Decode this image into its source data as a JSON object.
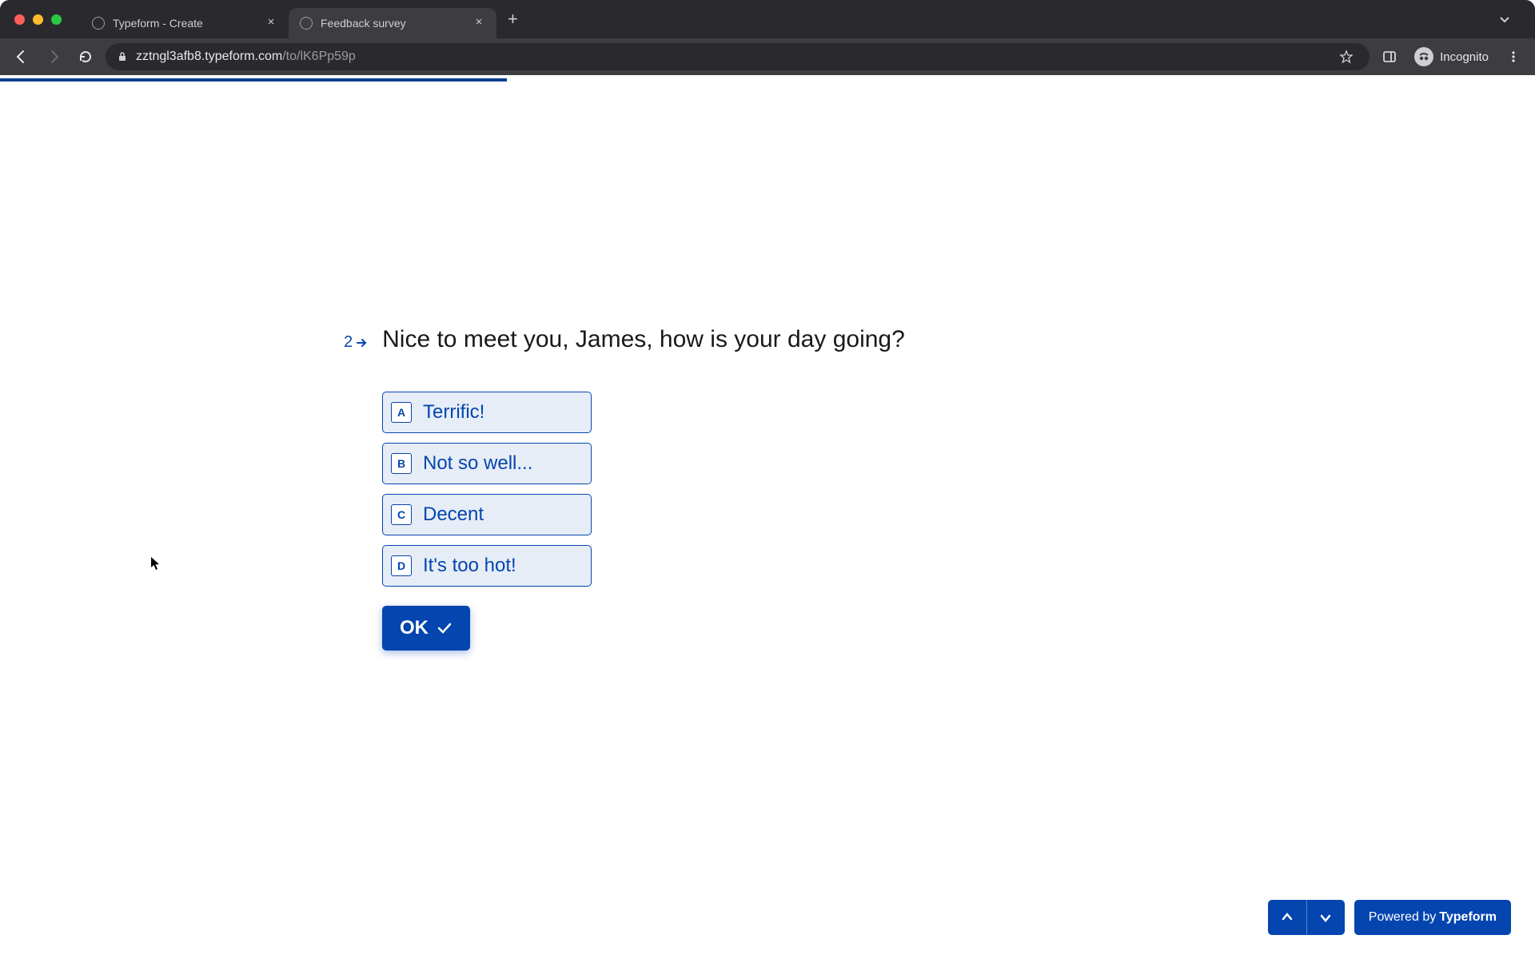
{
  "browser": {
    "tabs": [
      {
        "title": "Typeform - Create",
        "active": false
      },
      {
        "title": "Feedback survey",
        "active": true
      }
    ],
    "url_domain": "zztngl3afb8.typeform.com",
    "url_path": "/to/lK6Pp59p",
    "incognito_label": "Incognito"
  },
  "progress": {
    "percent": 33
  },
  "form": {
    "question_number": "2",
    "question_text": "Nice to meet you, James, how is your day going?",
    "choices": [
      {
        "key": "A",
        "label": "Terrific!"
      },
      {
        "key": "B",
        "label": "Not so well..."
      },
      {
        "key": "C",
        "label": "Decent"
      },
      {
        "key": "D",
        "label": "It's too hot!"
      }
    ],
    "ok_label": "OK"
  },
  "footer": {
    "powered_prefix": "Powered by",
    "powered_brand": "Typeform"
  }
}
